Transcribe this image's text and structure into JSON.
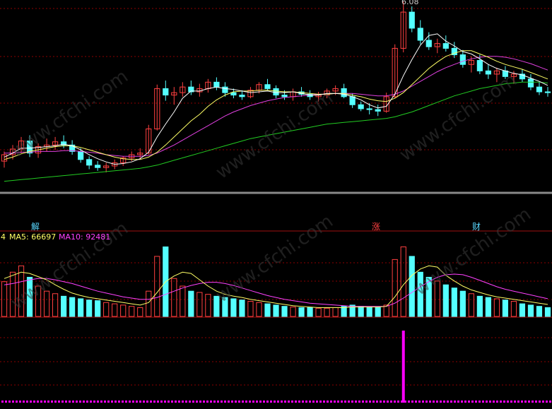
{
  "peak_label": "6.08",
  "markers": [
    {
      "text": "解",
      "color": "#5ad8ff"
    },
    {
      "text": "涨",
      "color": "#ff4040"
    },
    {
      "text": "财",
      "color": "#5ad8ff"
    }
  ],
  "volume_legend": {
    "prefix": "4",
    "ma5_label": "MA5: 66697",
    "ma10_label": "MA10: 92481",
    "ma5_color": "#ffff66",
    "ma10_color": "#ff40ff"
  },
  "watermark": "www.cfchi.com",
  "colors": {
    "up": "#ff4040",
    "down": "#54ffff",
    "ma_short": "#ffffff",
    "ma_yellow": "#ffff66",
    "ma_magenta": "#e040e0",
    "ma_green": "#22cc22",
    "grid": "#8b0000",
    "separator": "#8a8a8a",
    "bottom_bar": "#ff00ff"
  },
  "chart_data": {
    "type": "candlestick",
    "description_units": "price",
    "candles": [
      {
        "o": 4.1,
        "h": 4.22,
        "l": 4.02,
        "c": 4.18
      },
      {
        "o": 4.18,
        "h": 4.3,
        "l": 4.12,
        "c": 4.25
      },
      {
        "o": 4.25,
        "h": 4.4,
        "l": 4.2,
        "c": 4.35
      },
      {
        "o": 4.35,
        "h": 4.42,
        "l": 4.15,
        "c": 4.2
      },
      {
        "o": 4.2,
        "h": 4.32,
        "l": 4.14,
        "c": 4.28
      },
      {
        "o": 4.28,
        "h": 4.38,
        "l": 4.22,
        "c": 4.3
      },
      {
        "o": 4.3,
        "h": 4.4,
        "l": 4.24,
        "c": 4.34
      },
      {
        "o": 4.34,
        "h": 4.42,
        "l": 4.26,
        "c": 4.3
      },
      {
        "o": 4.3,
        "h": 4.36,
        "l": 4.18,
        "c": 4.22
      },
      {
        "o": 4.22,
        "h": 4.26,
        "l": 4.08,
        "c": 4.12
      },
      {
        "o": 4.12,
        "h": 4.16,
        "l": 4.0,
        "c": 4.05
      },
      {
        "o": 4.05,
        "h": 4.1,
        "l": 3.98,
        "c": 4.02
      },
      {
        "o": 4.02,
        "h": 4.08,
        "l": 3.96,
        "c": 4.04
      },
      {
        "o": 4.04,
        "h": 4.12,
        "l": 4.0,
        "c": 4.08
      },
      {
        "o": 4.08,
        "h": 4.16,
        "l": 4.04,
        "c": 4.14
      },
      {
        "o": 4.14,
        "h": 4.22,
        "l": 4.1,
        "c": 4.18
      },
      {
        "o": 4.18,
        "h": 4.26,
        "l": 4.12,
        "c": 4.2
      },
      {
        "o": 4.2,
        "h": 4.55,
        "l": 4.18,
        "c": 4.5
      },
      {
        "o": 4.5,
        "h": 5.05,
        "l": 4.48,
        "c": 5.0
      },
      {
        "o": 5.0,
        "h": 5.1,
        "l": 4.85,
        "c": 4.92
      },
      {
        "o": 4.92,
        "h": 5.02,
        "l": 4.8,
        "c": 4.95
      },
      {
        "o": 4.95,
        "h": 5.08,
        "l": 4.9,
        "c": 5.02
      },
      {
        "o": 5.02,
        "h": 5.1,
        "l": 4.92,
        "c": 4.96
      },
      {
        "o": 4.96,
        "h": 5.06,
        "l": 4.9,
        "c": 5.0
      },
      {
        "o": 5.0,
        "h": 5.12,
        "l": 4.95,
        "c": 5.08
      },
      {
        "o": 5.08,
        "h": 5.14,
        "l": 4.98,
        "c": 5.02
      },
      {
        "o": 5.02,
        "h": 5.08,
        "l": 4.9,
        "c": 4.95
      },
      {
        "o": 4.95,
        "h": 5.0,
        "l": 4.88,
        "c": 4.92
      },
      {
        "o": 4.92,
        "h": 4.98,
        "l": 4.86,
        "c": 4.9
      },
      {
        "o": 4.9,
        "h": 5.02,
        "l": 4.88,
        "c": 4.98
      },
      {
        "o": 4.98,
        "h": 5.08,
        "l": 4.94,
        "c": 5.05
      },
      {
        "o": 5.05,
        "h": 5.12,
        "l": 4.98,
        "c": 5.0
      },
      {
        "o": 5.0,
        "h": 5.04,
        "l": 4.88,
        "c": 4.92
      },
      {
        "o": 4.92,
        "h": 4.98,
        "l": 4.86,
        "c": 4.9
      },
      {
        "o": 4.9,
        "h": 5.0,
        "l": 4.85,
        "c": 4.96
      },
      {
        "o": 4.96,
        "h": 5.02,
        "l": 4.9,
        "c": 4.93
      },
      {
        "o": 4.93,
        "h": 4.98,
        "l": 4.86,
        "c": 4.9
      },
      {
        "o": 4.9,
        "h": 4.96,
        "l": 4.84,
        "c": 4.92
      },
      {
        "o": 4.92,
        "h": 5.0,
        "l": 4.88,
        "c": 4.97
      },
      {
        "o": 4.97,
        "h": 5.04,
        "l": 4.92,
        "c": 5.0
      },
      {
        "o": 5.0,
        "h": 5.06,
        "l": 4.88,
        "c": 4.9
      },
      {
        "o": 4.9,
        "h": 4.94,
        "l": 4.76,
        "c": 4.8
      },
      {
        "o": 4.8,
        "h": 4.84,
        "l": 4.72,
        "c": 4.75
      },
      {
        "o": 4.75,
        "h": 4.82,
        "l": 4.68,
        "c": 4.74
      },
      {
        "o": 4.74,
        "h": 4.8,
        "l": 4.66,
        "c": 4.72
      },
      {
        "o": 4.72,
        "h": 4.95,
        "l": 4.7,
        "c": 4.9
      },
      {
        "o": 4.9,
        "h": 5.55,
        "l": 4.88,
        "c": 5.5
      },
      {
        "o": 5.5,
        "h": 6.08,
        "l": 5.45,
        "c": 5.95
      },
      {
        "o": 5.95,
        "h": 6.02,
        "l": 5.7,
        "c": 5.75
      },
      {
        "o": 5.75,
        "h": 5.85,
        "l": 5.55,
        "c": 5.6
      },
      {
        "o": 5.6,
        "h": 5.7,
        "l": 5.48,
        "c": 5.52
      },
      {
        "o": 5.52,
        "h": 5.62,
        "l": 5.44,
        "c": 5.56
      },
      {
        "o": 5.56,
        "h": 5.66,
        "l": 5.46,
        "c": 5.5
      },
      {
        "o": 5.5,
        "h": 5.58,
        "l": 5.38,
        "c": 5.42
      },
      {
        "o": 5.42,
        "h": 5.48,
        "l": 5.26,
        "c": 5.3
      },
      {
        "o": 5.3,
        "h": 5.4,
        "l": 5.2,
        "c": 5.35
      },
      {
        "o": 5.35,
        "h": 5.42,
        "l": 5.18,
        "c": 5.22
      },
      {
        "o": 5.22,
        "h": 5.3,
        "l": 5.12,
        "c": 5.18
      },
      {
        "o": 5.18,
        "h": 5.26,
        "l": 5.08,
        "c": 5.22
      },
      {
        "o": 5.22,
        "h": 5.28,
        "l": 5.12,
        "c": 5.15
      },
      {
        "o": 5.15,
        "h": 5.22,
        "l": 5.06,
        "c": 5.18
      },
      {
        "o": 5.18,
        "h": 5.24,
        "l": 5.08,
        "c": 5.12
      },
      {
        "o": 5.12,
        "h": 5.18,
        "l": 4.98,
        "c": 5.02
      },
      {
        "o": 5.02,
        "h": 5.08,
        "l": 4.92,
        "c": 4.96
      },
      {
        "o": 4.96,
        "h": 5.02,
        "l": 4.9,
        "c": 4.95
      }
    ],
    "ma_short": [
      4.15,
      4.2,
      4.26,
      4.26,
      4.27,
      4.28,
      4.29,
      4.31,
      4.29,
      4.24,
      4.18,
      4.13,
      4.09,
      4.06,
      4.07,
      4.09,
      4.13,
      4.21,
      4.4,
      4.56,
      4.71,
      4.88,
      4.97,
      4.97,
      5.0,
      5.02,
      5.0,
      4.99,
      4.97,
      4.95,
      4.96,
      4.97,
      4.95,
      4.95,
      4.96,
      4.94,
      4.92,
      4.92,
      4.94,
      4.94,
      4.93,
      4.9,
      4.86,
      4.8,
      4.76,
      4.78,
      4.93,
      5.16,
      5.36,
      5.54,
      5.66,
      5.68,
      5.59,
      5.53,
      5.46,
      5.43,
      5.37,
      5.3,
      5.25,
      5.22,
      5.19,
      5.17,
      5.13,
      5.09,
      5.04
    ],
    "ma_yellow": [
      4.12,
      4.15,
      4.19,
      4.22,
      4.24,
      4.26,
      4.28,
      4.29,
      4.29,
      4.27,
      4.24,
      4.21,
      4.18,
      4.15,
      4.13,
      4.12,
      4.12,
      4.15,
      4.21,
      4.3,
      4.4,
      4.5,
      4.6,
      4.68,
      4.78,
      4.86,
      4.92,
      4.96,
      4.97,
      4.97,
      4.98,
      4.98,
      4.97,
      4.96,
      4.96,
      4.95,
      4.94,
      4.93,
      4.93,
      4.94,
      4.94,
      4.92,
      4.9,
      4.87,
      4.85,
      4.84,
      4.88,
      4.95,
      5.05,
      5.15,
      5.25,
      5.33,
      5.4,
      5.44,
      5.47,
      5.47,
      5.43,
      5.39,
      5.34,
      5.3,
      5.27,
      5.24,
      5.2,
      5.16,
      5.12
    ],
    "ma_magenta": [
      4.2,
      4.2,
      4.21,
      4.21,
      4.22,
      4.22,
      4.22,
      4.23,
      4.23,
      4.22,
      4.21,
      4.2,
      4.18,
      4.17,
      4.16,
      4.16,
      4.16,
      4.17,
      4.2,
      4.25,
      4.3,
      4.36,
      4.42,
      4.48,
      4.54,
      4.6,
      4.66,
      4.71,
      4.75,
      4.79,
      4.82,
      4.85,
      4.87,
      4.89,
      4.9,
      4.91,
      4.92,
      4.93,
      4.93,
      4.94,
      4.94,
      4.94,
      4.93,
      4.92,
      4.91,
      4.91,
      4.93,
      4.97,
      5.03,
      5.09,
      5.15,
      5.21,
      5.26,
      5.3,
      5.34,
      5.37,
      5.39,
      5.4,
      5.4,
      5.39,
      5.37,
      5.34,
      5.31,
      5.27,
      5.23
    ],
    "ma_green": [
      3.85,
      3.86,
      3.87,
      3.88,
      3.89,
      3.9,
      3.91,
      3.92,
      3.93,
      3.94,
      3.95,
      3.96,
      3.97,
      3.98,
      3.99,
      4.0,
      4.01,
      4.03,
      4.05,
      4.08,
      4.11,
      4.14,
      4.17,
      4.2,
      4.23,
      4.26,
      4.29,
      4.32,
      4.35,
      4.38,
      4.4,
      4.42,
      4.44,
      4.46,
      4.48,
      4.5,
      4.52,
      4.54,
      4.56,
      4.57,
      4.58,
      4.59,
      4.6,
      4.61,
      4.62,
      4.63,
      4.65,
      4.68,
      4.71,
      4.75,
      4.79,
      4.83,
      4.87,
      4.91,
      4.94,
      4.97,
      5.0,
      5.02,
      5.04,
      5.06,
      5.07,
      5.08,
      5.08,
      5.08,
      5.07
    ],
    "volume": [
      55,
      70,
      80,
      62,
      48,
      40,
      36,
      32,
      30,
      28,
      26,
      25,
      22,
      20,
      18,
      16,
      14,
      40,
      95,
      110,
      60,
      48,
      40,
      38,
      35,
      32,
      30,
      28,
      26,
      24,
      22,
      20,
      18,
      16,
      15,
      14,
      14,
      13,
      13,
      14,
      16,
      18,
      16,
      15,
      14,
      18,
      90,
      110,
      95,
      70,
      62,
      56,
      50,
      45,
      40,
      36,
      32,
      30,
      28,
      26,
      24,
      20,
      18,
      16,
      14
    ],
    "vol_ma5": [
      60,
      65,
      70,
      68,
      63,
      58,
      50,
      43,
      37,
      33,
      30,
      28,
      26,
      24,
      22,
      20,
      18,
      22,
      38,
      55,
      64,
      70,
      68,
      58,
      48,
      40,
      35,
      32,
      30,
      27,
      25,
      23,
      21,
      19,
      17,
      16,
      15,
      14,
      14,
      14,
      14,
      15,
      15,
      15,
      15,
      16,
      31,
      50,
      65,
      75,
      80,
      78,
      65,
      56,
      48,
      42,
      38,
      34,
      31,
      29,
      27,
      25,
      23,
      21,
      19
    ],
    "vol_ma10": [
      50,
      52,
      55,
      58,
      60,
      60,
      58,
      55,
      52,
      48,
      44,
      40,
      37,
      34,
      31,
      29,
      27,
      27,
      30,
      35,
      40,
      45,
      49,
      52,
      54,
      54,
      52,
      49,
      45,
      41,
      37,
      33,
      30,
      27,
      25,
      23,
      21,
      20,
      19,
      18,
      17,
      16,
      16,
      16,
      16,
      16,
      21,
      29,
      38,
      47,
      55,
      62,
      66,
      67,
      66,
      62,
      57,
      52,
      47,
      43,
      40,
      37,
      34,
      31,
      28
    ],
    "bottom_spike_index": 47
  }
}
